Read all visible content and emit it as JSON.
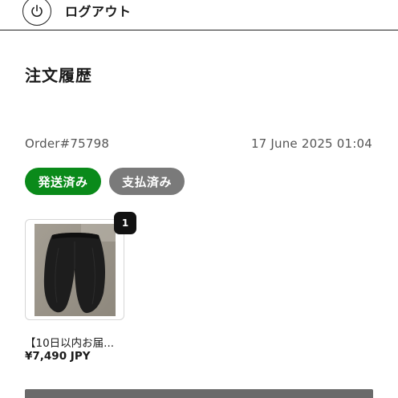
{
  "header": {
    "logout_label": "ログアウト",
    "logout_icon": "power-icon"
  },
  "main": {
    "title": "注文履歴"
  },
  "order": {
    "number": "Order#75798",
    "date": "17 June 2025 01:04",
    "badges": [
      {
        "label": "発送済み",
        "color": "#0a8a1a"
      },
      {
        "label": "支払済み",
        "color": "#7a7a7a"
      }
    ],
    "items": [
      {
        "name": "【10日以内お届...",
        "price": "¥7,490 JPY",
        "quantity": "1",
        "image": "black-wide-pants-photo"
      }
    ]
  },
  "colors": {
    "shipped_badge": "#0a8a1a",
    "paid_badge": "#7a7a7a",
    "qty_badge": "#111111",
    "bottom_button": "#6a6a6a"
  }
}
